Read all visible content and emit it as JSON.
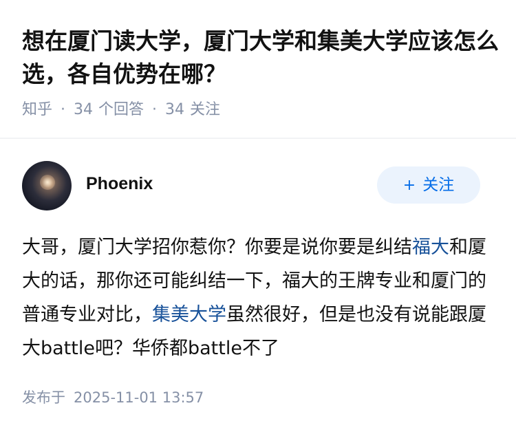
{
  "question": {
    "title": "想在厦门读大学，厦门大学和集美大学应该怎么选，各自优势在哪？",
    "source": "知乎",
    "answer_count": "34",
    "answer_label": "个回答",
    "follower_count": "34",
    "follower_label": "关注",
    "separator": "·"
  },
  "answer": {
    "author": {
      "name": "Phoenix",
      "avatar": "avatar-image"
    },
    "follow_button": {
      "plus": "+",
      "label": "关注"
    },
    "content": {
      "seg1": "大哥，厦门大学招你惹你？你要是说你要是纠结",
      "link1": "福大",
      "seg2": "和厦大的话，那你还可能纠结一下，福大的王牌专业和厦门的普通专业对比，",
      "link2": "集美大学",
      "seg3": "虽然很好，但是也没有说能跟厦大battle吧？华侨都battle不了"
    },
    "publish": {
      "label": "发布于",
      "datetime": "2025-11-01 13:57"
    }
  },
  "colors": {
    "link": "#175199",
    "accent": "#056de8",
    "meta": "#8590a6",
    "text": "#121212"
  }
}
